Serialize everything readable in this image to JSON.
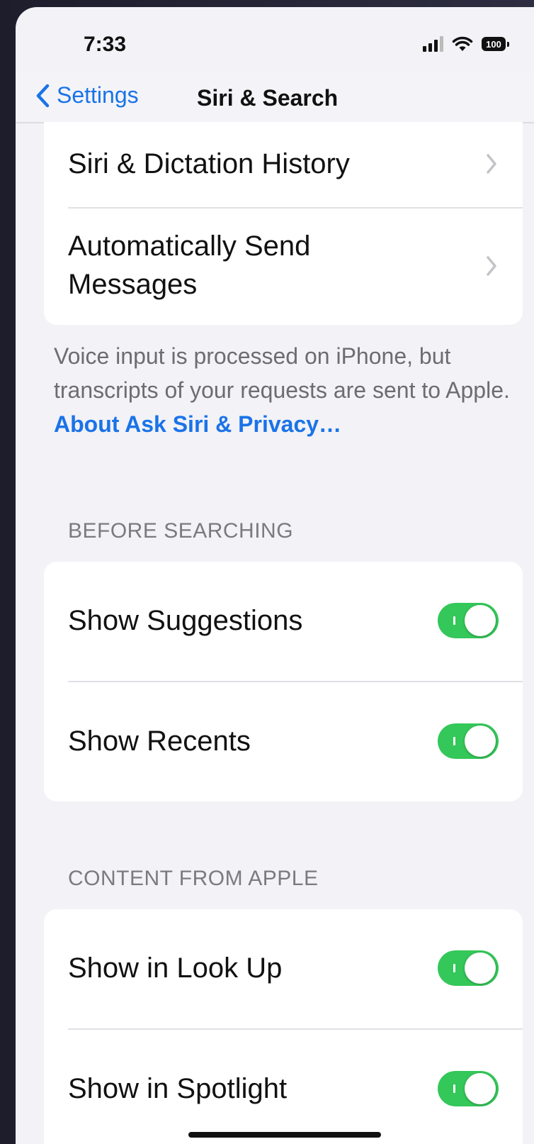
{
  "status_bar": {
    "time": "7:33",
    "battery": "100"
  },
  "nav": {
    "back_label": "Settings",
    "title": "Siri & Search"
  },
  "top_group": {
    "items": [
      {
        "label": "Siri & Dictation History"
      },
      {
        "label": "Automatically Send Messages"
      }
    ]
  },
  "footnote": {
    "text": "Voice input is processed on iPhone, but transcripts of your requests are sent to Apple. ",
    "link": "About Ask Siri & Privacy…"
  },
  "before_searching": {
    "header": "BEFORE SEARCHING",
    "items": [
      {
        "label": "Show Suggestions",
        "on": true
      },
      {
        "label": "Show Recents",
        "on": true
      }
    ]
  },
  "content_from_apple": {
    "header": "CONTENT FROM APPLE",
    "items": [
      {
        "label": "Show in Look Up",
        "on": true
      },
      {
        "label": "Show in Spotlight",
        "on": true
      }
    ]
  },
  "colors": {
    "accent": "#1a73e8",
    "toggle_on": "#34c759",
    "background": "#f2f2f7"
  }
}
